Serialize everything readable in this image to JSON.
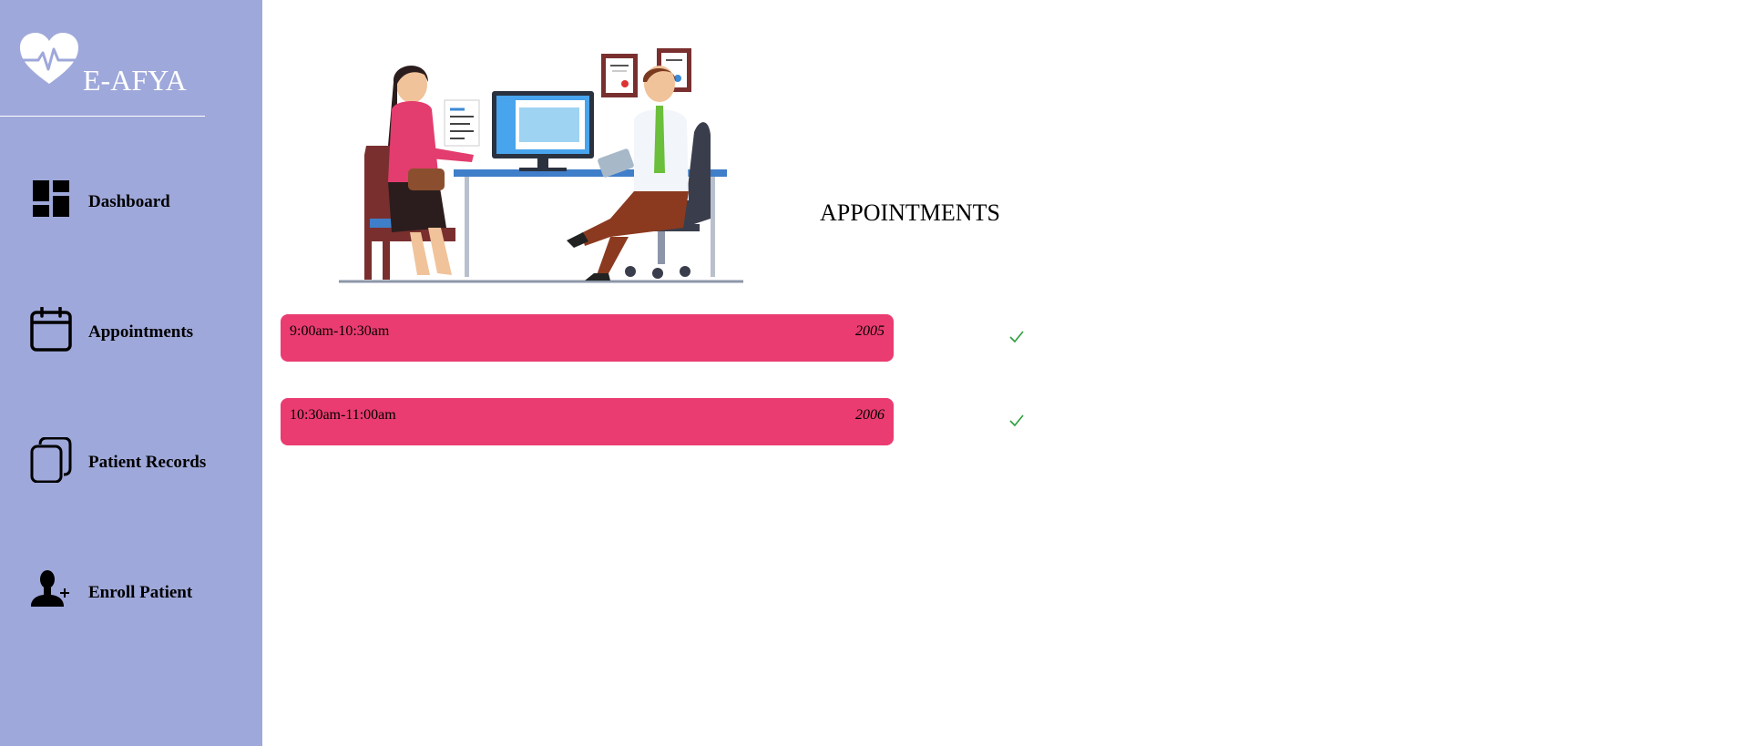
{
  "brand": {
    "name": "E-AFYA",
    "icon": "heart-pulse-icon"
  },
  "sidebar": {
    "items": [
      {
        "label": "Dashboard",
        "icon": "dashboard-icon"
      },
      {
        "label": "Appointments",
        "icon": "calendar-icon"
      },
      {
        "label": "Patient Records",
        "icon": "documents-icon"
      },
      {
        "label": "Enroll Patient",
        "icon": "add-user-icon"
      }
    ]
  },
  "main": {
    "title": "APPOINTMENTS",
    "illustration": "doctor-consultation-illustration",
    "appointments": [
      {
        "time": "9:00am-10:30am",
        "id": "2005",
        "status_icon": "check-icon"
      },
      {
        "time": "10:30am-11:00am",
        "id": "2006",
        "status_icon": "check-icon"
      }
    ]
  },
  "colors": {
    "sidebar_bg": "#9fa8da",
    "appointment_bg": "#ea3c71",
    "check": "#2e9e3e"
  }
}
